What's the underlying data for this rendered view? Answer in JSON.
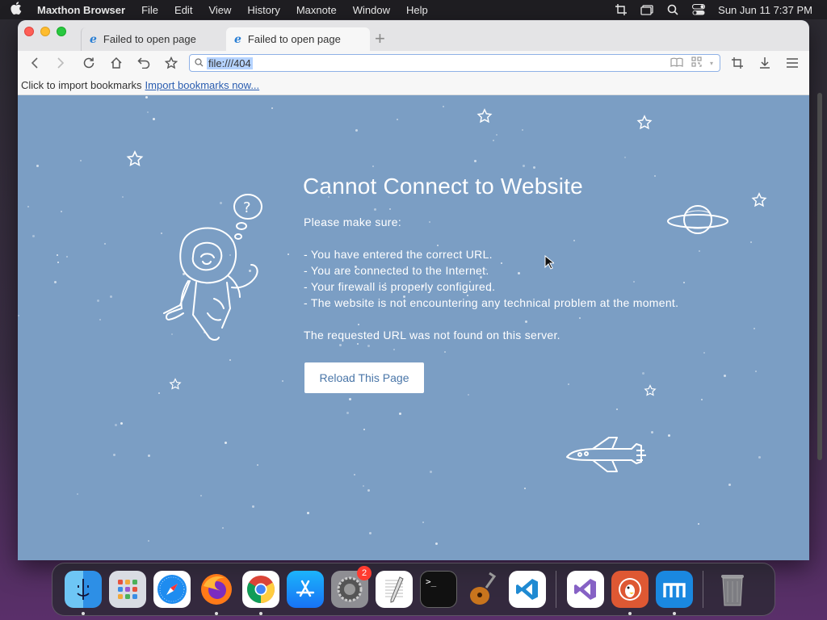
{
  "menubar": {
    "app_name": "Maxthon Browser",
    "items": [
      "File",
      "Edit",
      "View",
      "History",
      "Maxnote",
      "Window",
      "Help"
    ],
    "clock": "Sun Jun 11  7:37 PM"
  },
  "tabs": [
    {
      "title": "Failed to open page",
      "icon": "ie-icon",
      "active": false
    },
    {
      "title": "Failed to open page",
      "icon": "ie-icon",
      "active": true
    }
  ],
  "toolbar": {
    "url": "file:///404"
  },
  "bookmarks_bar": {
    "prompt": "Click to import bookmarks",
    "link": "Import bookmarks now..."
  },
  "error_page": {
    "title": "Cannot Connect to Website",
    "intro": "Please make sure:",
    "checklist": [
      "- You have entered the correct URL.",
      "- You are connected to the Internet.",
      "- Your firewall is properly configured.",
      "- The website is not encountering any technical problem at the moment."
    ],
    "detail": "The requested URL was not found on this server.",
    "reload_label": "Reload This Page",
    "background_color": "#7b9ec4"
  },
  "dock": {
    "apps": [
      {
        "name": "Finder",
        "icon": "finder-icon"
      },
      {
        "name": "Launchpad",
        "icon": "launchpad-icon"
      },
      {
        "name": "Safari",
        "icon": "safari-icon"
      },
      {
        "name": "Firefox",
        "icon": "firefox-icon"
      },
      {
        "name": "Chrome",
        "icon": "chrome-icon"
      },
      {
        "name": "App Store",
        "icon": "appstore-icon"
      },
      {
        "name": "System Settings",
        "icon": "settings-icon",
        "badge": "2"
      },
      {
        "name": "TextEdit",
        "icon": "textedit-icon"
      },
      {
        "name": "Terminal",
        "icon": "terminal-icon",
        "glyph": ">_"
      },
      {
        "name": "GarageBand",
        "icon": "garageband-icon"
      },
      {
        "name": "Visual Studio Code",
        "icon": "vscode-icon"
      },
      {
        "name": "Visual Studio",
        "icon": "visualstudio-icon"
      },
      {
        "name": "DuckDuckGo",
        "icon": "duckduckgo-icon"
      },
      {
        "name": "Maxthon",
        "icon": "maxthon-icon"
      },
      {
        "name": "Trash",
        "icon": "trash-icon"
      }
    ]
  }
}
